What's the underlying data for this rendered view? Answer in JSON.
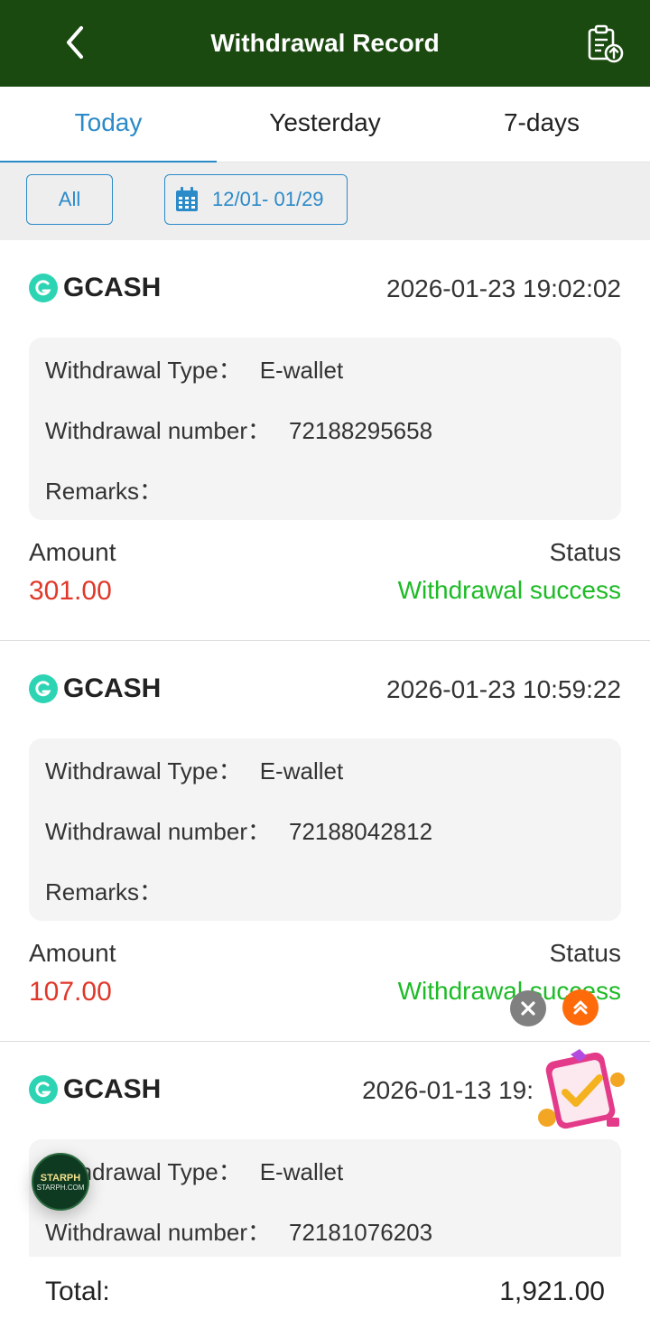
{
  "header": {
    "title": "Withdrawal Record",
    "back_icon": "chevron-left-icon",
    "upload_icon": "clipboard-upload-icon"
  },
  "tabs": [
    {
      "label": "Today",
      "active": true
    },
    {
      "label": "Yesterday",
      "active": false
    },
    {
      "label": "7-days",
      "active": false
    }
  ],
  "filters": {
    "all_label": "All",
    "date_range": "12/01- 01/29",
    "calendar_icon": "calendar-icon"
  },
  "labels": {
    "withdrawal_type": "Withdrawal Type：",
    "withdrawal_number": "Withdrawal number：",
    "remarks": "Remarks：",
    "amount": "Amount",
    "status": "Status"
  },
  "records": [
    {
      "method": "GCASH",
      "time": "2026-01-23 19:02:02",
      "type": "E-wallet",
      "number": "72188295658",
      "remarks": "",
      "amount": "301.00",
      "status": "Withdrawal success"
    },
    {
      "method": "GCASH",
      "time": "2026-01-23 10:59:22",
      "type": "E-wallet",
      "number": "72188042812",
      "remarks": "",
      "amount": "107.00",
      "status": "Withdrawal success"
    },
    {
      "method": "GCASH",
      "time": "2026-01-13 19:",
      "type": "E-wallet",
      "number": "72181076203"
    }
  ],
  "floating": {
    "starph_text": "STARPH",
    "starph_sub": "STARPH.COM"
  },
  "footer": {
    "total_label": "Total:",
    "total_value": "1,921.00"
  },
  "colors": {
    "header_bg": "#1b4a10",
    "accent": "#2b8ac8",
    "amount": "#e0382a",
    "success": "#1dbb26"
  }
}
